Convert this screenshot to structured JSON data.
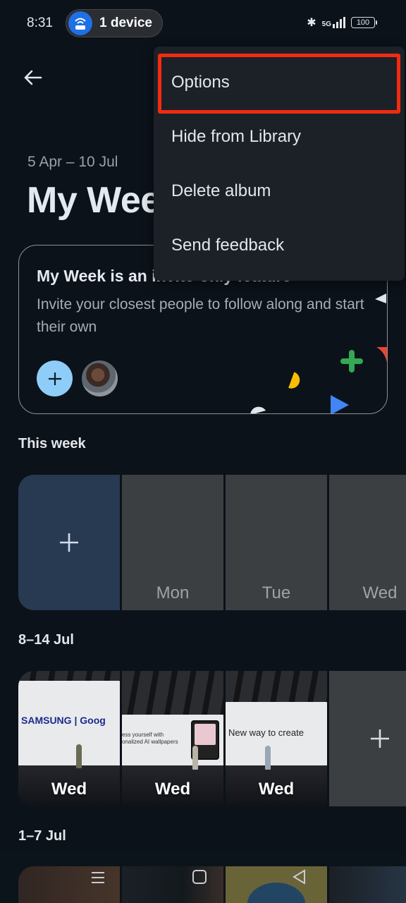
{
  "status_bar": {
    "time": "8:31",
    "hotspot_label": "1 device",
    "network": "5G",
    "battery": "100"
  },
  "header": {
    "date_range": "5 Apr – 10 Jul",
    "title": "My Week"
  },
  "invite_card": {
    "title": "My Week is an invite-only feature",
    "description": "Invite your closest people to follow along and start their own"
  },
  "sections": {
    "this_week": {
      "title": "This week",
      "days": [
        "Mon",
        "Tue",
        "Wed"
      ]
    },
    "jul_8_14": {
      "title": "8–14 Jul",
      "photos": [
        {
          "label": "Wed",
          "screen_text": "SAMSUNG | Goog"
        },
        {
          "label": "Wed",
          "screen_text": "ess yourself with onalized AI wallpapers"
        },
        {
          "label": "Wed",
          "screen_text": "New way to create"
        }
      ]
    },
    "jul_1_7": {
      "title": "1–7 Jul"
    }
  },
  "menu": {
    "items": [
      "Options",
      "Hide from Library",
      "Delete album",
      "Send feedback"
    ],
    "highlighted": "Options"
  },
  "colors": {
    "background": "#0b121a",
    "menu_bg": "#1c2128",
    "highlight": "#f22b11",
    "add_tile": "#273a52",
    "invite_add": "#8fcdf9"
  }
}
